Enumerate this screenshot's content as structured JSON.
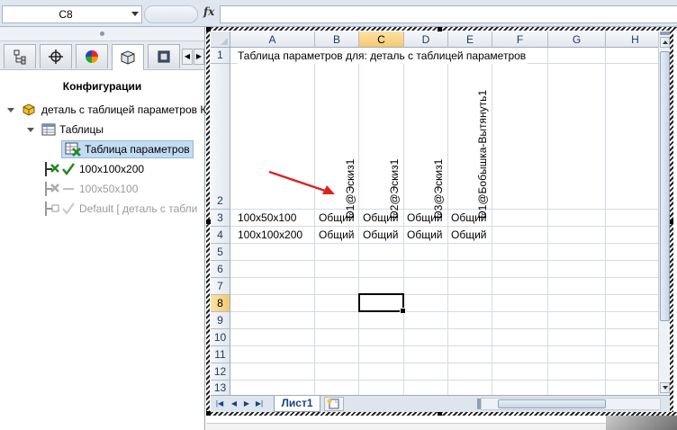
{
  "formula_bar": {
    "namebox_value": "C8",
    "fx_label": "fx",
    "formula_value": ""
  },
  "left_panel": {
    "title": "Конфигурации",
    "tree": {
      "root": "деталь с таблицей параметров К",
      "tables_folder": "Таблицы",
      "design_table": "Таблица параметров",
      "config_1": "100x100x200",
      "config_2": "100x50x100",
      "config_3": "Default [ деталь с табли"
    }
  },
  "sheet": {
    "column_headers": [
      "A",
      "B",
      "C",
      "D",
      "E",
      "F",
      "G",
      "H"
    ],
    "row_headers": [
      "1",
      "2",
      "3",
      "4",
      "5",
      "6",
      "7",
      "8",
      "9",
      "10",
      "11",
      "12",
      "13"
    ],
    "selected_column": "C",
    "selected_row": "8",
    "cells": {
      "A1": "Таблица параметров для: деталь с таблицей параметров",
      "B2": "D1@Эскиз1",
      "C2": "D2@Эскиз1",
      "D2": "D3@Эскиз1",
      "E2": "D1@Бобышка-Вытянуть1",
      "A3": "100x50x100",
      "B3": "Общий",
      "C3": "Общий",
      "D3": "Общий",
      "E3": "Общий",
      "A4": "100x100x200",
      "B4": "Общий",
      "C4": "Общий",
      "D4": "Общий",
      "E4": "Общий"
    },
    "sheet_tab": "Лист1"
  },
  "colors": {
    "selected_header": "#f4c96e",
    "annotation_arrow": "#e02020",
    "check_green": "#1d8a1d"
  }
}
